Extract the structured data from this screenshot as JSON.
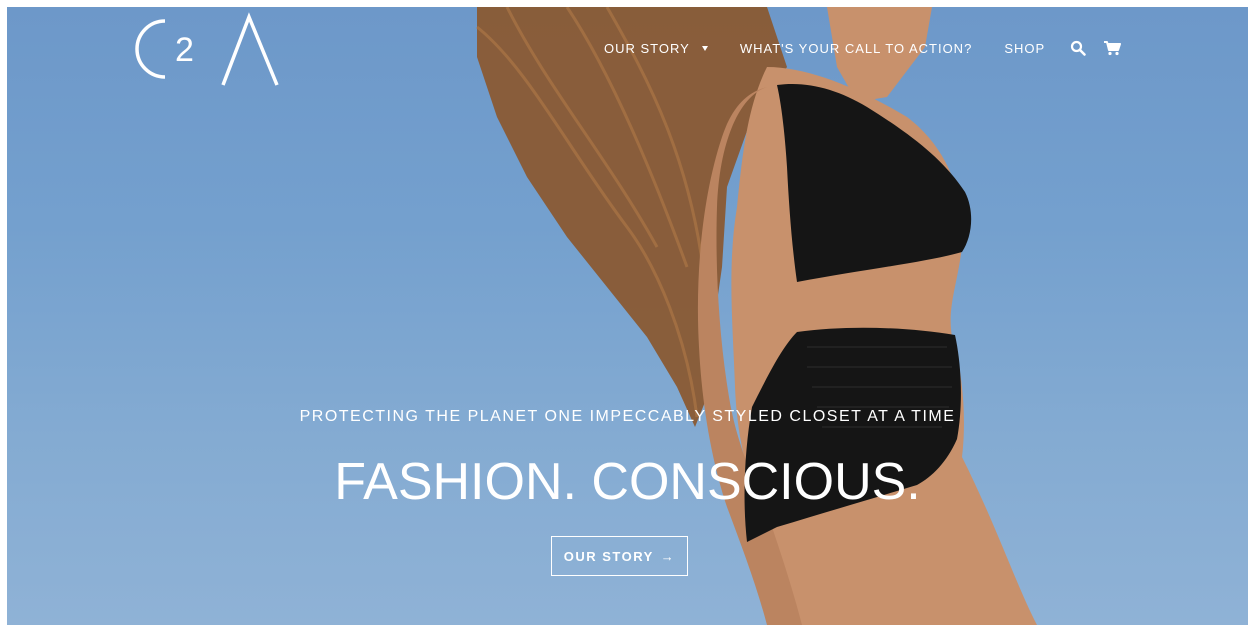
{
  "brand": {
    "logo_text": "C2Λ"
  },
  "nav": {
    "items": [
      {
        "label": "OUR STORY",
        "has_dropdown": true
      },
      {
        "label": "WHAT'S YOUR CALL TO ACTION?"
      },
      {
        "label": "SHOP"
      }
    ],
    "icons": [
      "search-icon",
      "cart-icon"
    ]
  },
  "hero": {
    "tagline": "PROTECTING THE PLANET ONE IMPECCABLY STYLED CLOSET AT A TIME",
    "headline": "FASHION. CONSCIOUS.",
    "button_label": "OUR STORY",
    "button_arrow": "→"
  },
  "colors": {
    "sky": "#74a0ce",
    "text": "#ffffff",
    "swimwear": "#151515",
    "skin": "#c8916c",
    "hair": "#8a5a33"
  }
}
